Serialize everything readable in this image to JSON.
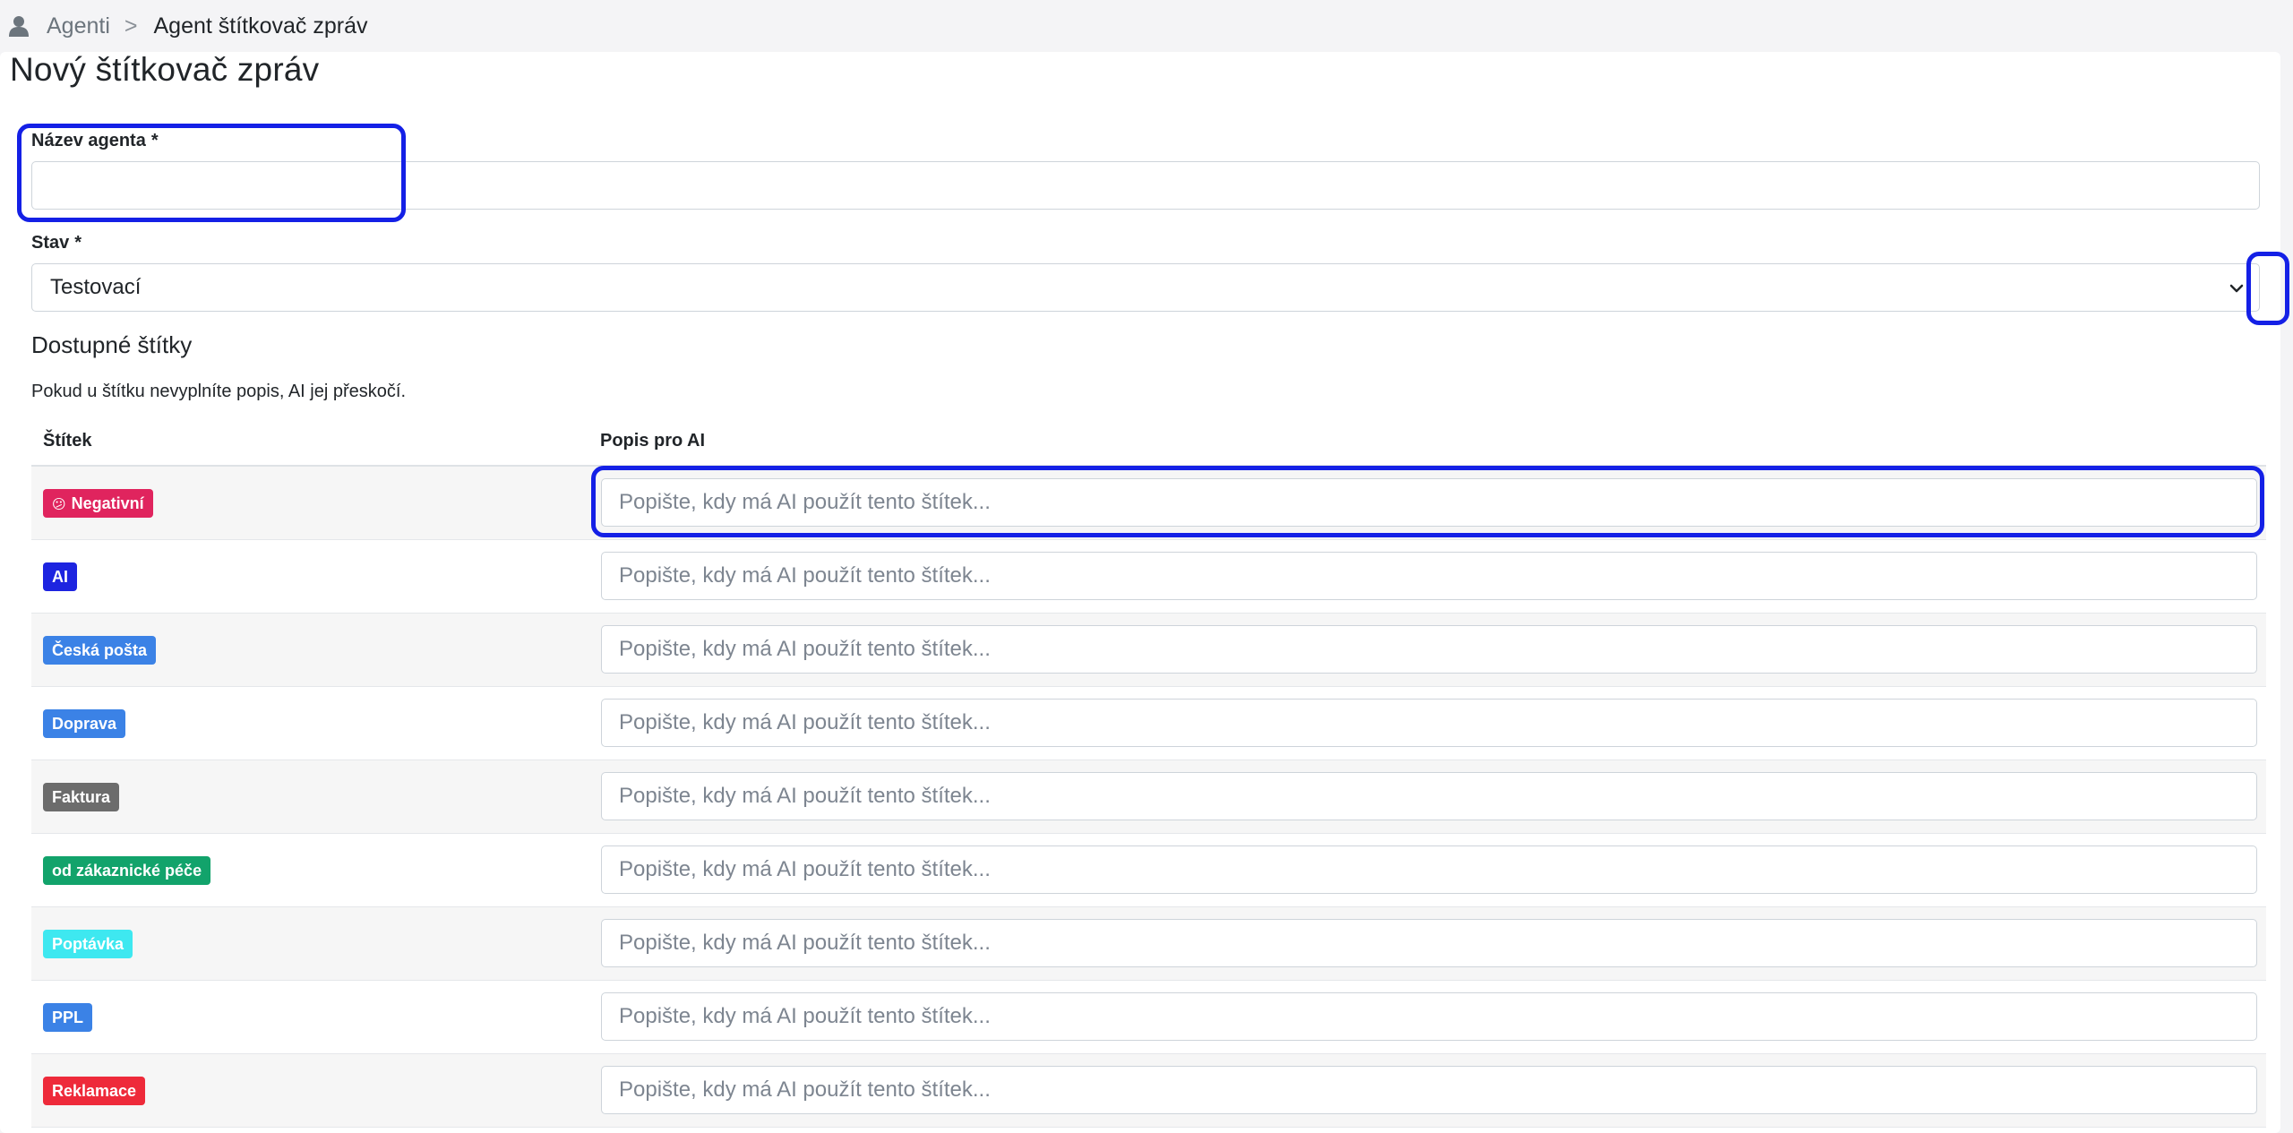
{
  "breadcrumb": {
    "parent": "Agenti",
    "separator": ">",
    "current": "Agent štítkovač zpráv"
  },
  "page_title": "Nový štítkovač zpráv",
  "form": {
    "name_label": "Název agenta",
    "name_required": "*",
    "name_value": "",
    "status_label": "Stav",
    "status_required": "*",
    "status_value": "Testovací"
  },
  "labels_section": {
    "title": "Dostupné štítky",
    "hint": "Pokud u štítku nevyplníte popis, AI jej přeskočí.",
    "col_label": "Štítek",
    "col_description": "Popis pro AI",
    "placeholder": "Popište, kdy má AI použít tento štítek...",
    "rows": [
      {
        "label": "Negativní",
        "emoji": "😕",
        "color": "#e0245e"
      },
      {
        "label": "AI",
        "emoji": "",
        "color": "#1d24e0"
      },
      {
        "label": "Česká pošta",
        "emoji": "",
        "color": "#3b82e6"
      },
      {
        "label": "Doprava",
        "emoji": "",
        "color": "#3b82e6"
      },
      {
        "label": "Faktura",
        "emoji": "",
        "color": "#6c6c6c"
      },
      {
        "label": "od zákaznické péče",
        "emoji": "",
        "color": "#12a36b"
      },
      {
        "label": "Poptávka",
        "emoji": "",
        "color": "#3ee8f0"
      },
      {
        "label": "PPL",
        "emoji": "",
        "color": "#3b82e6"
      },
      {
        "label": "Reklamace",
        "emoji": "",
        "color": "#ee2a3a"
      }
    ]
  },
  "colors": {
    "highlight": "#1420e6"
  }
}
